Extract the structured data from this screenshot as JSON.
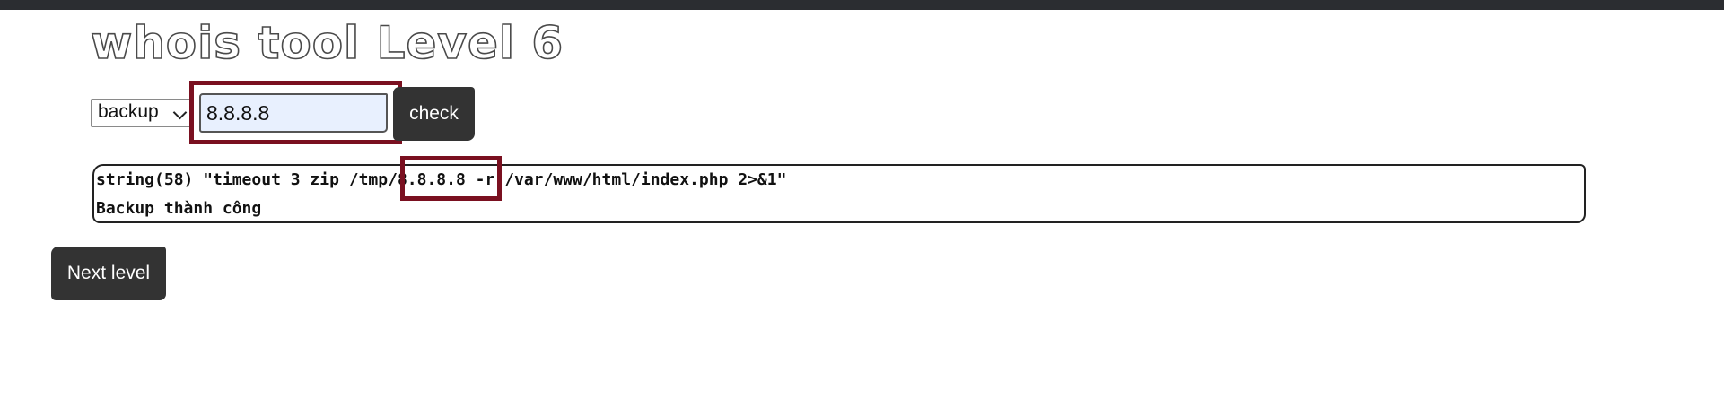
{
  "page": {
    "title": "whois tool Level 6"
  },
  "form": {
    "action_select": {
      "selected": "backup"
    },
    "host_input": {
      "value": "8.8.8.8"
    },
    "check_label": "check"
  },
  "output": {
    "lines": [
      "string(58) \"timeout 3 zip /tmp/8.8.8.8 -r /var/www/html/index.php 2>&1\"",
      "Backup thành công"
    ]
  },
  "next_level_label": "Next level",
  "colors": {
    "highlight": "#7a1020",
    "button_bg": "#333333",
    "input_bg": "#e8f0fe"
  }
}
